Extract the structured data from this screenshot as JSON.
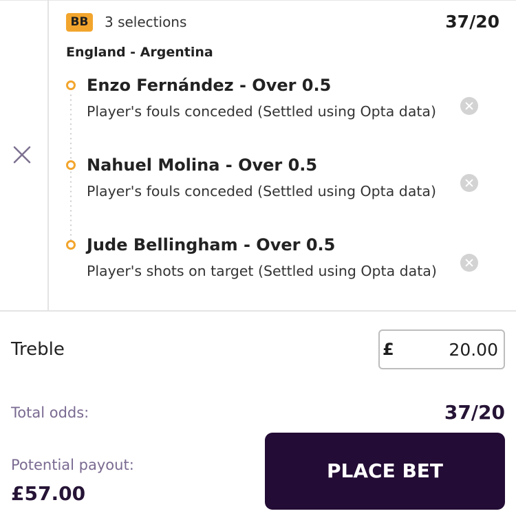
{
  "slip": {
    "badge": "BB",
    "selections_text": "3 selections",
    "odds": "37/20",
    "match": "England - Argentina",
    "legs": [
      {
        "title": "Enzo Fernández - Over 0.5",
        "description": "Player's fouls conceded (Settled using Opta data)"
      },
      {
        "title": "Nahuel Molina - Over 0.5",
        "description": "Player's fouls conceded (Settled using Opta data)"
      },
      {
        "title": "Jude Bellingham - Over 0.5",
        "description": "Player's shots on target (Settled using Opta data)"
      }
    ]
  },
  "stake": {
    "bet_type": "Treble",
    "currency": "£",
    "value": "20.00"
  },
  "summary": {
    "total_odds_label": "Total odds:",
    "total_odds": "37/20",
    "payout_label": "Potential payout:",
    "payout": "£57.00"
  },
  "actions": {
    "place_bet_label": "PLACE BET"
  },
  "colors": {
    "accent": "#f2a52d",
    "button": "#230c35",
    "label": "#7a6a91"
  }
}
